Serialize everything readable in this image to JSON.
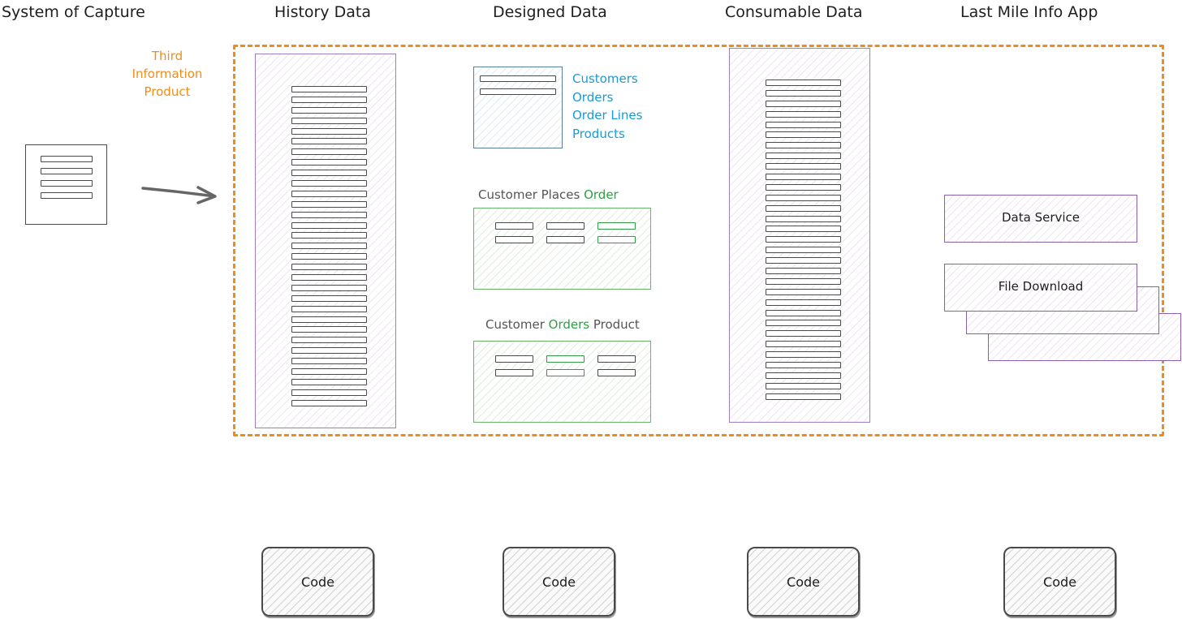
{
  "columns": {
    "system_of_capture": "System of Capture",
    "history_data": "History Data",
    "designed_data": "Designed Data",
    "consumable_data": "Consumable Data",
    "last_mile": "Last Mile Info App"
  },
  "third_information_product": [
    "Third",
    "Information",
    "Product"
  ],
  "entities": [
    "Customers",
    "Orders",
    "Order Lines",
    "Products"
  ],
  "customer_places_order": {
    "prefix": "Customer Places ",
    "highlight": "Order"
  },
  "customer_orders_product": {
    "prefix": "Customer ",
    "highlight": "Orders",
    "suffix": " Product"
  },
  "apps": {
    "data_service": "Data Service",
    "file_download": "File Download"
  },
  "code_label": "Code",
  "colors": {
    "frame": "#f08c1a",
    "entities": "#1c9ad6",
    "highlight": "#2f9e44",
    "purple_panel": "#a07cc0",
    "green_panel": "#6bb06b",
    "blue_panel": "#5b7fa3"
  }
}
